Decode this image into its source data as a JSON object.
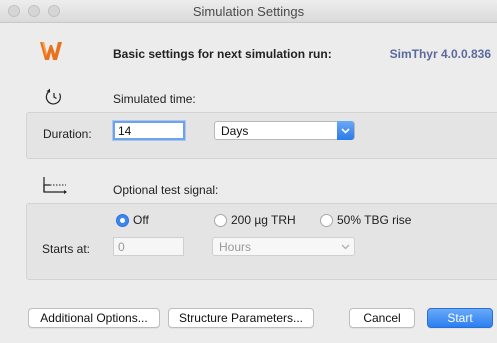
{
  "window": {
    "title": "Simulation Settings"
  },
  "header": {
    "title": "Basic settings for next simulation run:",
    "version": "SimThyr 4.0.0.836"
  },
  "simulated_time": {
    "label": "Simulated time:",
    "duration_label": "Duration:",
    "duration_value": "14",
    "unit_value": "Days"
  },
  "test_signal": {
    "label": "Optional test signal:",
    "options": [
      "Off",
      "200 µg TRH",
      "50% TBG rise"
    ],
    "selected": "Off",
    "starts_label": "Starts at:",
    "starts_value": "0",
    "starts_unit": "Hours"
  },
  "buttons": {
    "additional": "Additional Options...",
    "structure": "Structure Parameters...",
    "cancel": "Cancel",
    "start": "Start"
  },
  "colors": {
    "accent": "#2c7ef0",
    "version_text": "#5b6a9c",
    "logo": "#e8731e"
  }
}
